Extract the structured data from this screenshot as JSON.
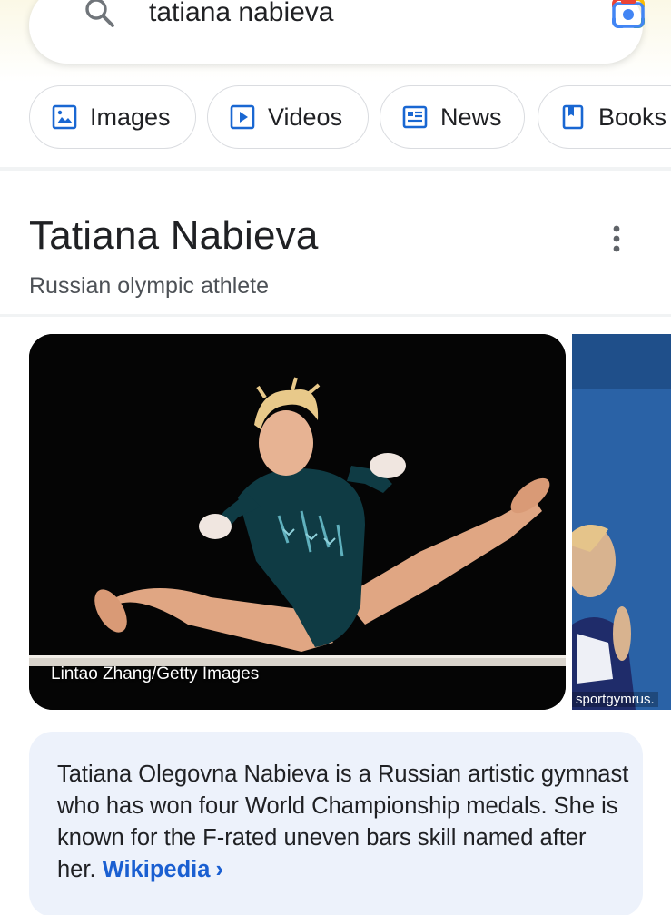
{
  "search": {
    "query": "tatiana nabieva"
  },
  "chips": [
    {
      "label": "Images",
      "icon": "image-icon"
    },
    {
      "label": "Videos",
      "icon": "play-icon"
    },
    {
      "label": "News",
      "icon": "newspaper-icon"
    },
    {
      "label": "Books",
      "icon": "book-icon"
    }
  ],
  "knowledge_panel": {
    "title": "Tatiana Nabieva",
    "subtitle": "Russian olympic athlete",
    "images": [
      {
        "credit": "Lintao Zhang/Getty Images"
      },
      {
        "credit": "sportgymrus."
      }
    ],
    "description": "Tatiana Olegovna Nabieva is a Russian artistic gymnast who has won four World Championship medals. She is known for the F-rated uneven bars skill named after her.",
    "source_link": "Wikipedia",
    "chevron": "›"
  },
  "colors": {
    "link": "#1a5fd1",
    "card_bg": "#edf2fb",
    "chip_border": "#dadce0"
  }
}
